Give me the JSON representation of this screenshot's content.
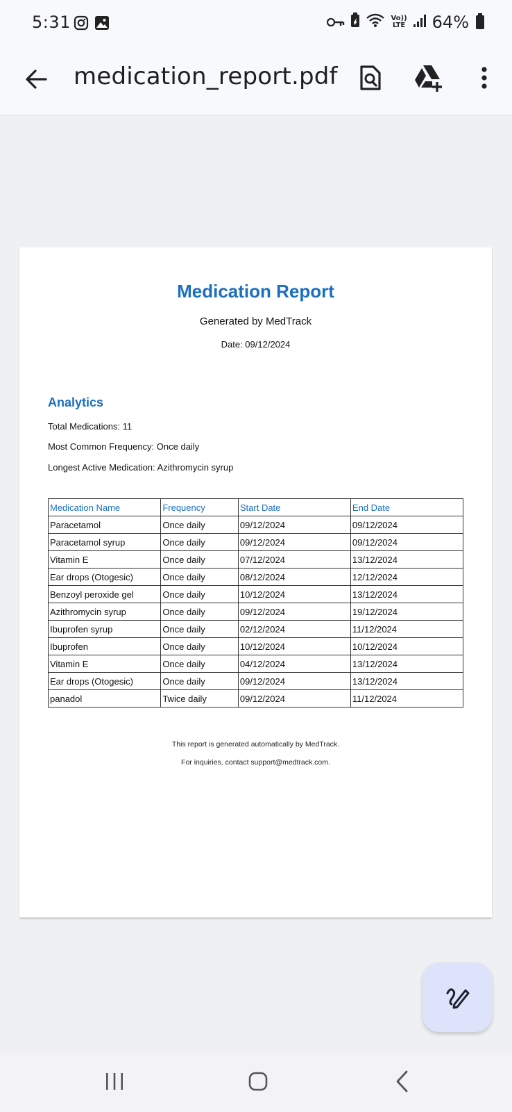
{
  "status_bar": {
    "time": "5:31",
    "battery_percent": "64%",
    "lte_top": "Vo))",
    "lte_bottom": "LTE"
  },
  "app_bar": {
    "title": "medication_report.pdf",
    "icons": [
      "back-arrow-icon",
      "find-in-page-icon",
      "drive-add-icon",
      "more-vert-icon"
    ]
  },
  "document": {
    "title": "Medication Report",
    "subtitle": "Generated by MedTrack",
    "date": "Date: 09/12/2024",
    "analytics": {
      "heading": "Analytics",
      "total": "Total Medications: 11",
      "common_frequency": "Most Common Frequency: Once daily",
      "longest_active": "Longest Active Medication: Azithromycin syrup"
    },
    "table": {
      "headers": [
        "Medication Name",
        "Frequency",
        "Start Date",
        "End Date"
      ],
      "rows": [
        [
          "Paracetamol",
          "Once daily",
          "09/12/2024",
          "09/12/2024"
        ],
        [
          "Paracetamol syrup",
          "Once daily",
          "09/12/2024",
          "09/12/2024"
        ],
        [
          "Vitamin E",
          "Once daily",
          "07/12/2024",
          "13/12/2024"
        ],
        [
          "Ear drops (Otogesic)",
          "Once daily",
          "08/12/2024",
          "12/12/2024"
        ],
        [
          "Benzoyl peroxide gel",
          "Once daily",
          "10/12/2024",
          "13/12/2024"
        ],
        [
          "Azithromycin syrup",
          "Once daily",
          "09/12/2024",
          "19/12/2024"
        ],
        [
          "Ibuprofen syrup",
          "Once daily",
          "02/12/2024",
          "11/12/2024"
        ],
        [
          "Ibuprofen",
          "Once daily",
          "10/12/2024",
          "10/12/2024"
        ],
        [
          "Vitamin E",
          "Once daily",
          "04/12/2024",
          "13/12/2024"
        ],
        [
          "Ear drops (Otogesic)",
          "Once daily",
          "09/12/2024",
          "13/12/2024"
        ],
        [
          "panadol",
          "Twice daily",
          "09/12/2024",
          "11/12/2024"
        ]
      ]
    },
    "footer": {
      "line1": "This report is generated automatically by MedTrack.",
      "line2": "For inquiries, contact support@medtrack.com."
    }
  },
  "fab": {
    "icon": "annotate-pen-icon"
  },
  "nav_bar": {
    "icons": [
      "recents-icon",
      "home-icon",
      "back-icon"
    ]
  },
  "colors": {
    "accent": "#1a6fbf",
    "fab_bg": "#dde3fa",
    "page_bg": "#eff0f3"
  }
}
